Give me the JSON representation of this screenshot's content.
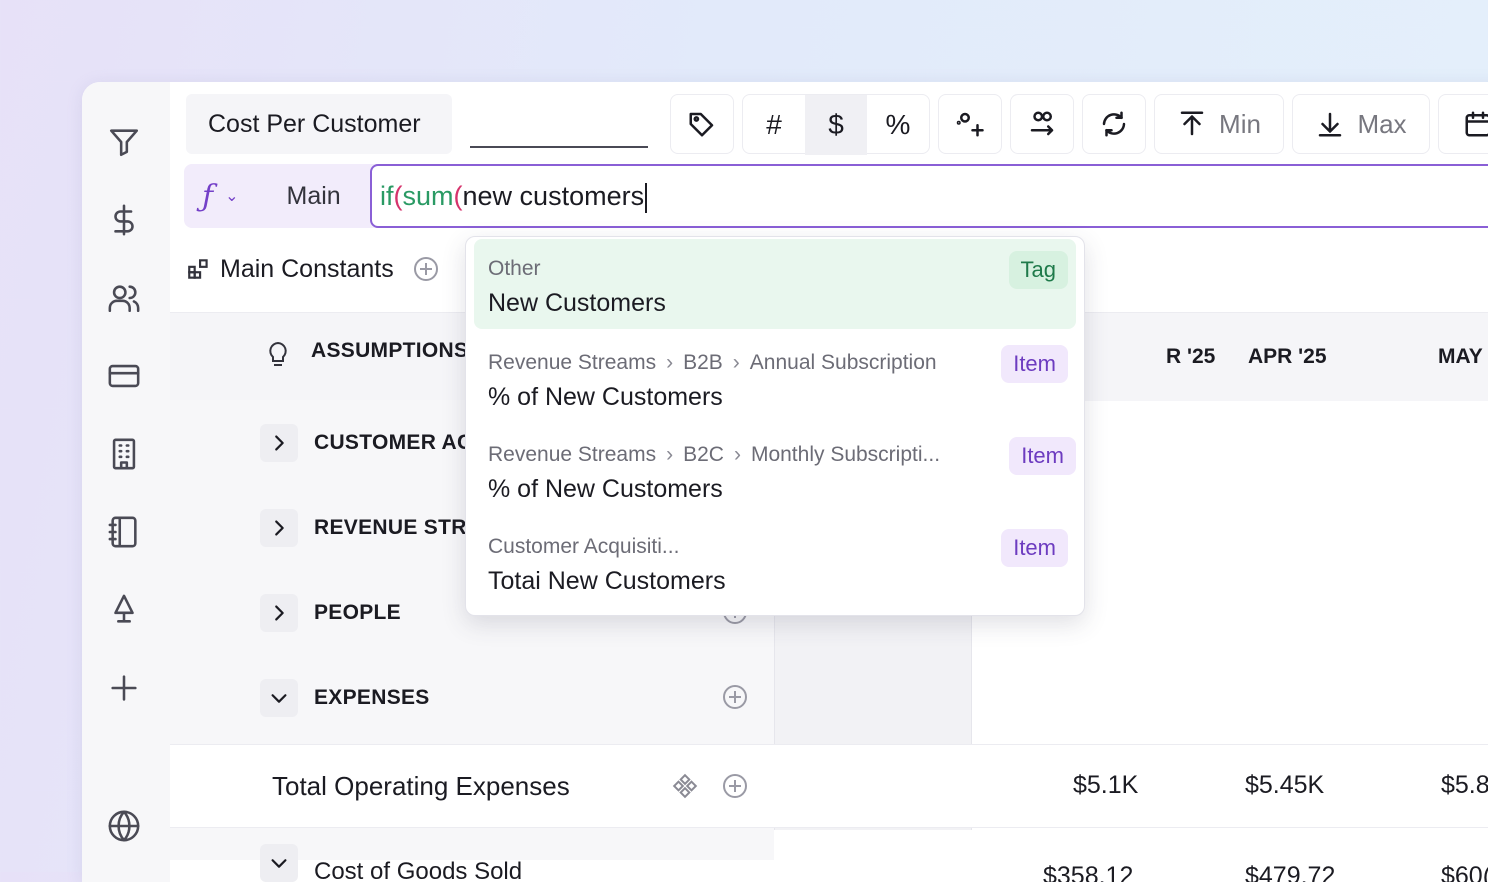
{
  "toolbar": {
    "title": "Cost Per Customer",
    "min_label": "Min",
    "max_label": "Max",
    "hash_symbol": "#",
    "dollar_symbol": "$",
    "percent_symbol": "%"
  },
  "formula": {
    "scope_label": "Main",
    "fx_symbol": "ƒ",
    "fn_if": "if",
    "paren1": "(",
    "fn_sum": "sum",
    "paren2": "(",
    "text": "new customers"
  },
  "constants": {
    "label": "Main Constants"
  },
  "grid": {
    "assumptions_label": "ASSUMPTIONS",
    "months": [
      "R '25",
      "APR '25",
      "MAY"
    ],
    "groups": [
      {
        "label": "CUSTOMER AC",
        "expanded": false
      },
      {
        "label": "REVENUE STR",
        "expanded": false
      },
      {
        "label": "PEOPLE",
        "expanded": false
      },
      {
        "label": "EXPENSES",
        "expanded": true
      }
    ],
    "total_row": {
      "label": "Total Operating Expenses",
      "values": [
        "$5.1K",
        "$5.45K",
        "$5.8"
      ]
    },
    "cogs_row": {
      "label": "Cost of Goods Sold",
      "values": [
        "$358.12",
        "$479.72",
        "$60("
      ]
    }
  },
  "autocomplete": [
    {
      "path": [
        "Other"
      ],
      "name": "New Customers",
      "badge": "Tag",
      "selected": true
    },
    {
      "path": [
        "Revenue Streams",
        "B2B",
        "Annual Subscription"
      ],
      "name": "% of New Customers",
      "badge": "Item",
      "selected": false
    },
    {
      "path": [
        "Revenue Streams",
        "B2C",
        "Monthly Subscripti..."
      ],
      "name": "% of New Customers",
      "badge": "Item",
      "selected": false
    },
    {
      "path": [
        "Customer Acquisiti..."
      ],
      "name": "Totai New Customers",
      "badge": "Item",
      "selected": false
    }
  ],
  "colors": {
    "accent": "#8a5fd6",
    "tag_green": "#1f7a4a",
    "item_purple": "#6d3cc0"
  }
}
